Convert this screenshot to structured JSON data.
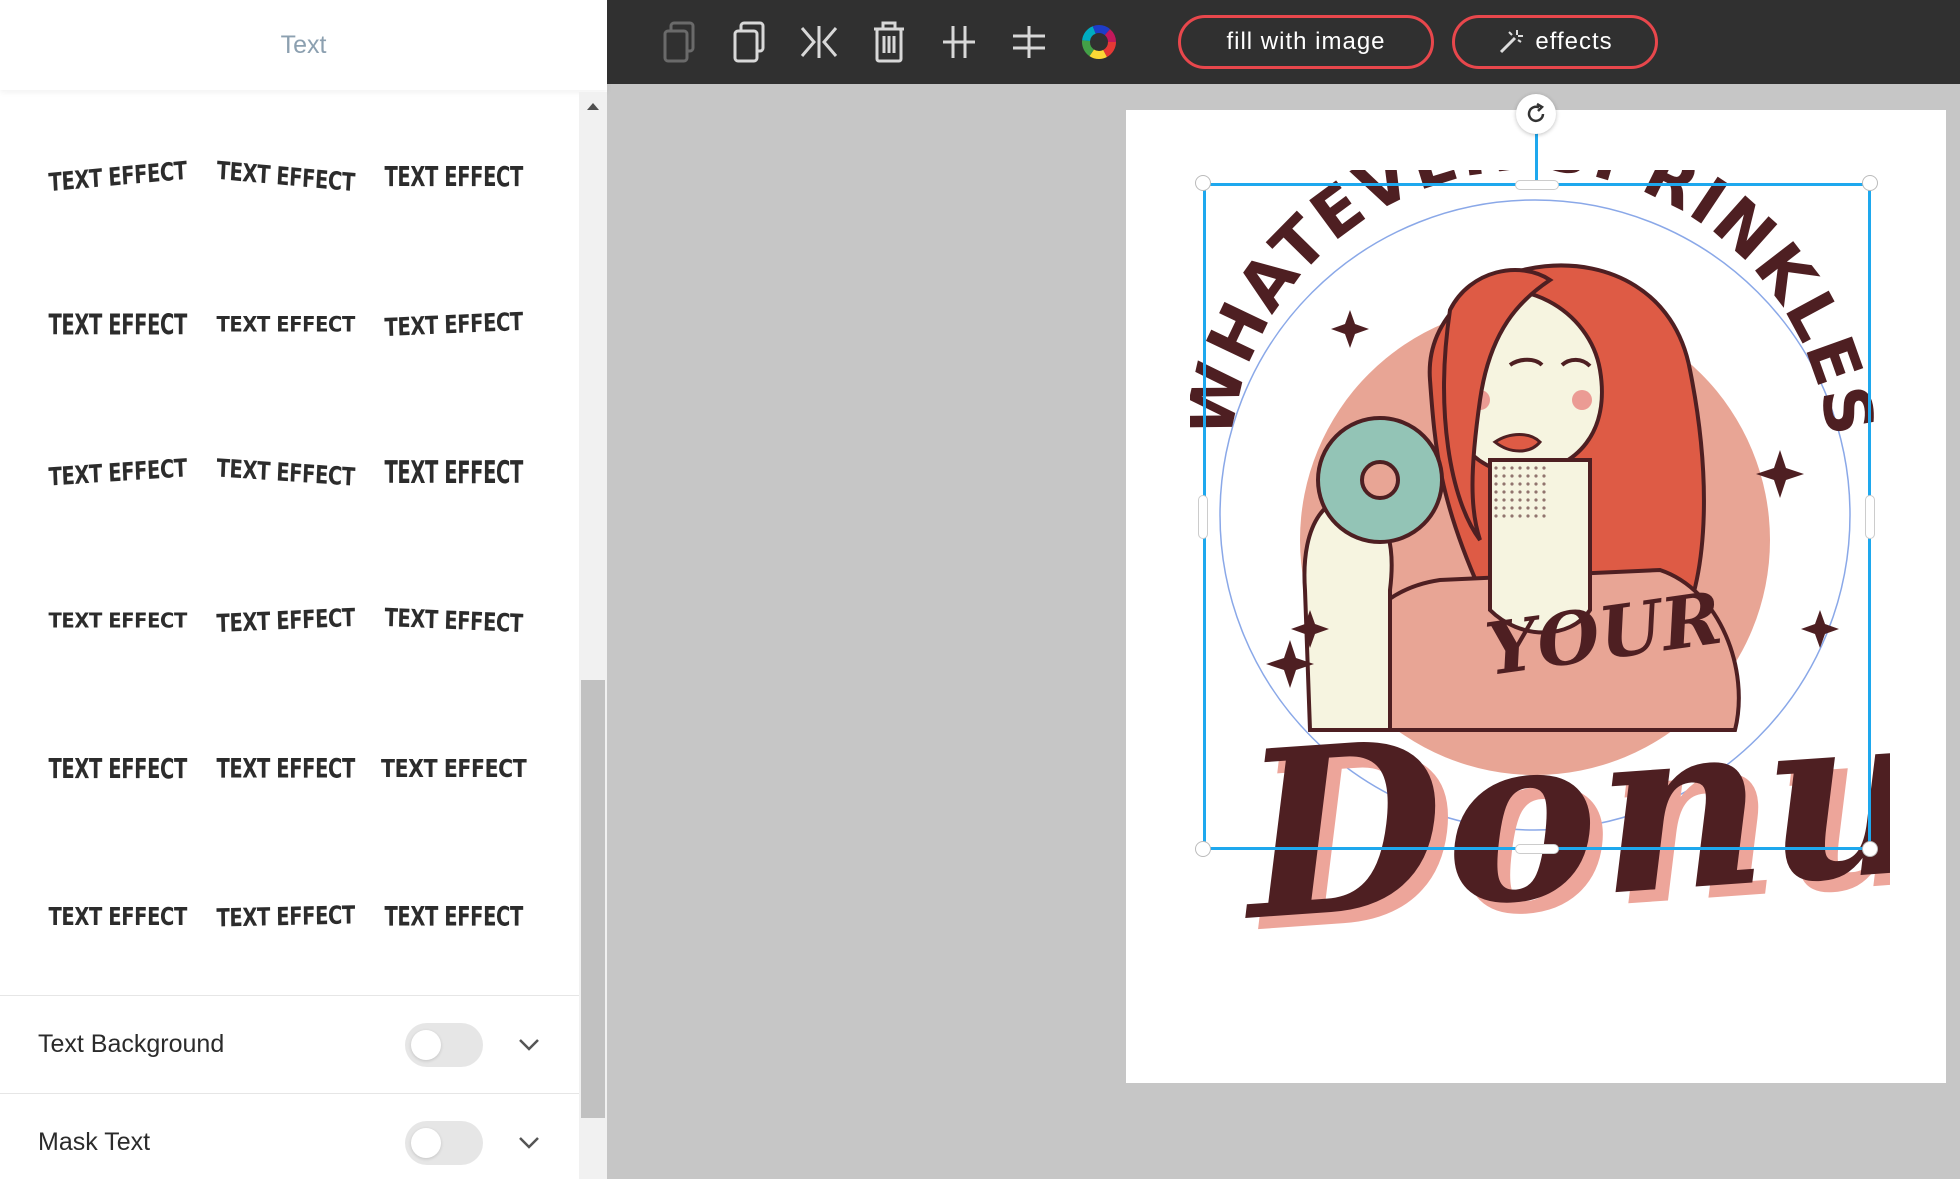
{
  "panel": {
    "title": "Text",
    "effects": [
      "TEXT EFFECT",
      "TEXT EFFECT",
      "TEXT EFFECT",
      "TEXT EFFECT",
      "TEXT EFFECT",
      "TEXT EFFECT",
      "TEXT EFFECT",
      "TEXT EFFECT",
      "TEXT EFFECT",
      "TEXT EFFECT",
      "TEXT EFFECT",
      "TEXT EFFECT",
      "TEXT EFFECT",
      "TEXT EFFECT",
      "TEXT EFFECT",
      "TEXT EFFECT",
      "TEXT EFFECT",
      "TEXT EFFECT"
    ],
    "settings": {
      "text_background": {
        "label": "Text Background",
        "enabled": false
      },
      "mask_text": {
        "label": "Mask Text",
        "enabled": false
      }
    }
  },
  "toolbar": {
    "fill_with_image": "fill with image",
    "effects": "effects",
    "icons": [
      "copy-icon",
      "duplicate-icon",
      "flip-icon",
      "delete-icon",
      "align-vertical-icon",
      "align-horizontal-icon",
      "color-wheel-icon"
    ]
  },
  "canvas": {
    "artwork_top_text": "WHATEVER SPRINKLES",
    "artwork_mid_text": "YOUR",
    "artwork_script_text": "Donut"
  },
  "colors": {
    "toolbar_bg": "#303030",
    "accent_red": "#e8474c",
    "selection_blue": "#1ea8ee",
    "art_brown": "#4e1f22",
    "art_salmon": "#e8a595",
    "art_hair": "#de5b45",
    "art_skin": "#f6f4e0",
    "art_donut": "#93c4b6"
  }
}
